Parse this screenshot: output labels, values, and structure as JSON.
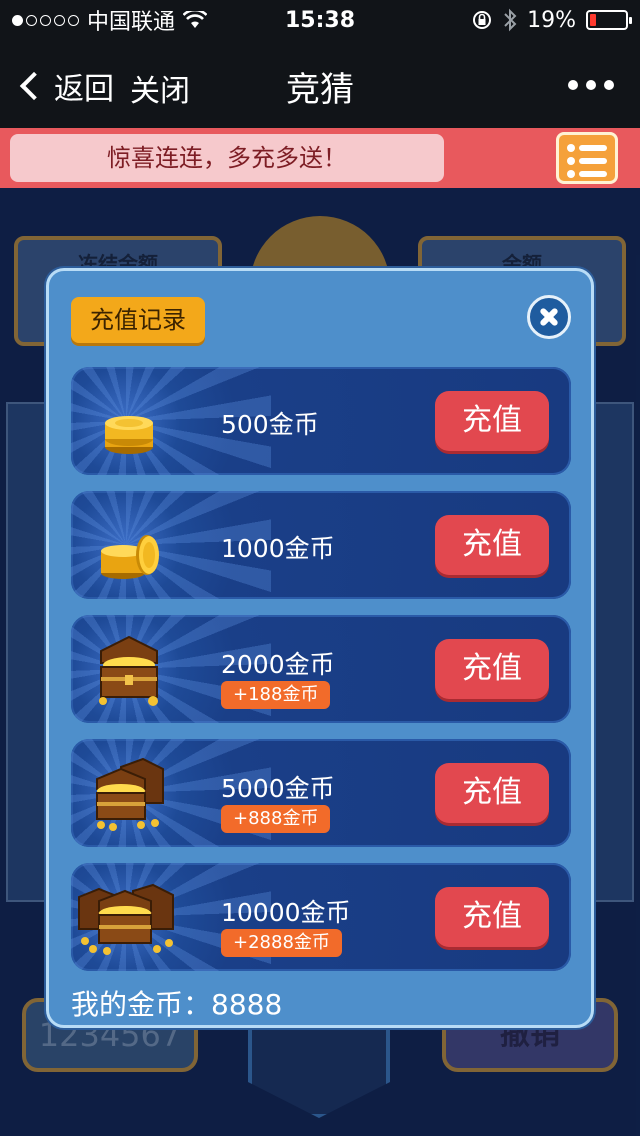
{
  "status_bar": {
    "carrier": "中国联通",
    "time": "15:38",
    "battery": "19%",
    "battery_level": 0.19
  },
  "nav": {
    "back_label": "返回",
    "close_label": "关闭",
    "title": "竞猜"
  },
  "banner": {
    "text": "惊喜连连，多充多送！"
  },
  "background": {
    "frozen_label": "冻结金额",
    "balance_label": "余额",
    "input_value": "1234567",
    "cancel_label": "撤销"
  },
  "modal": {
    "records_label": "充值记录",
    "packages": [
      {
        "amount": "500金币",
        "bonus": "",
        "button": "充值",
        "icon": "coin-stack-small-icon"
      },
      {
        "amount": "1000金币",
        "bonus": "",
        "button": "充值",
        "icon": "coin-stack-icon"
      },
      {
        "amount": "2000金币",
        "bonus": "+188金币",
        "button": "充值",
        "icon": "treasure-chest-icon"
      },
      {
        "amount": "5000金币",
        "bonus": "+888金币",
        "button": "充值",
        "icon": "treasure-chests-icon"
      },
      {
        "amount": "10000金币",
        "bonus": "+2888金币",
        "button": "充值",
        "icon": "treasure-chests-large-icon"
      }
    ],
    "my_coins_label": "我的金币：",
    "my_coins_value": "8888"
  },
  "colors": {
    "buy_button": "#e2484f",
    "bonus_badge": "#f26b2a",
    "records_button": "#f3a81a",
    "banner": "#e8595d"
  }
}
